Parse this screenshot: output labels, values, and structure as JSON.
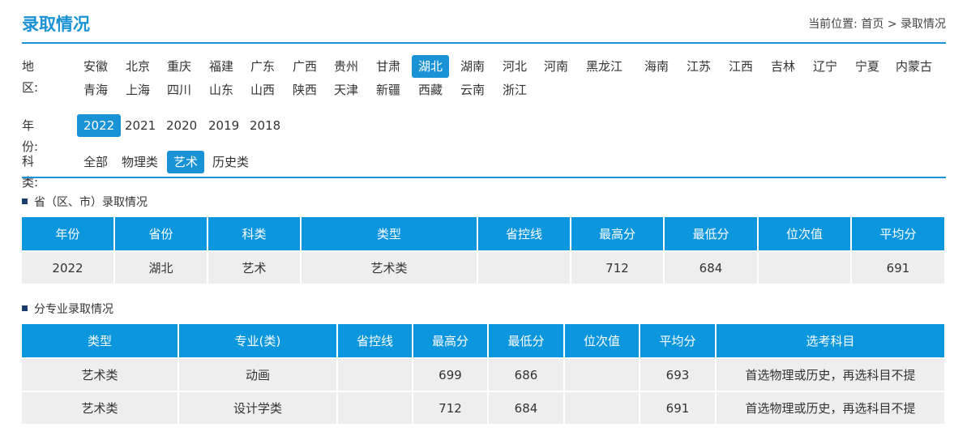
{
  "header": {
    "title": "录取情况",
    "breadcrumb": {
      "prefix": "当前位置:",
      "home": "首页",
      "sep": ">",
      "current": "录取情况"
    }
  },
  "filters": {
    "region": {
      "label": "地区:",
      "row1": [
        "安徽",
        "北京",
        "重庆",
        "福建",
        "广东",
        "广西",
        "贵州",
        "甘肃",
        "湖北",
        "湖南",
        "河北",
        "河南",
        "黑龙江",
        "海南",
        "江苏",
        "江西",
        "吉林",
        "辽宁",
        "宁夏",
        "内蒙古"
      ],
      "row2": [
        "青海",
        "上海",
        "四川",
        "山东",
        "山西",
        "陕西",
        "天津",
        "新疆",
        "西藏",
        "云南",
        "浙江"
      ],
      "selected": "湖北"
    },
    "year": {
      "label": "年份:",
      "options": [
        "2022",
        "2021",
        "2020",
        "2019",
        "2018"
      ],
      "selected": "2022"
    },
    "category": {
      "label": "科类:",
      "options": [
        "全部",
        "物理类",
        "艺术",
        "历史类"
      ],
      "selected": "艺术"
    }
  },
  "province_section": {
    "title": "省（区、市）录取情况",
    "headers": [
      "年份",
      "省份",
      "科类",
      "类型",
      "省控线",
      "最高分",
      "最低分",
      "位次值",
      "平均分"
    ],
    "rows": [
      [
        "2022",
        "湖北",
        "艺术",
        "艺术类",
        "",
        "712",
        "684",
        "",
        "691"
      ]
    ]
  },
  "major_section": {
    "title": "分专业录取情况",
    "headers": [
      "类型",
      "专业(类)",
      "省控线",
      "最高分",
      "最低分",
      "位次值",
      "平均分",
      "选考科目"
    ],
    "rows": [
      [
        "艺术类",
        "动画",
        "",
        "699",
        "686",
        "",
        "693",
        "首选物理或历史，再选科目不提"
      ],
      [
        "艺术类",
        "设计学类",
        "",
        "712",
        "684",
        "",
        "691",
        "首选物理或历史，再选科目不提"
      ]
    ]
  },
  "colors": {
    "accent": "#1a92d6",
    "header_bg": "#0b96dd",
    "row_bg": "#eeeeee"
  }
}
